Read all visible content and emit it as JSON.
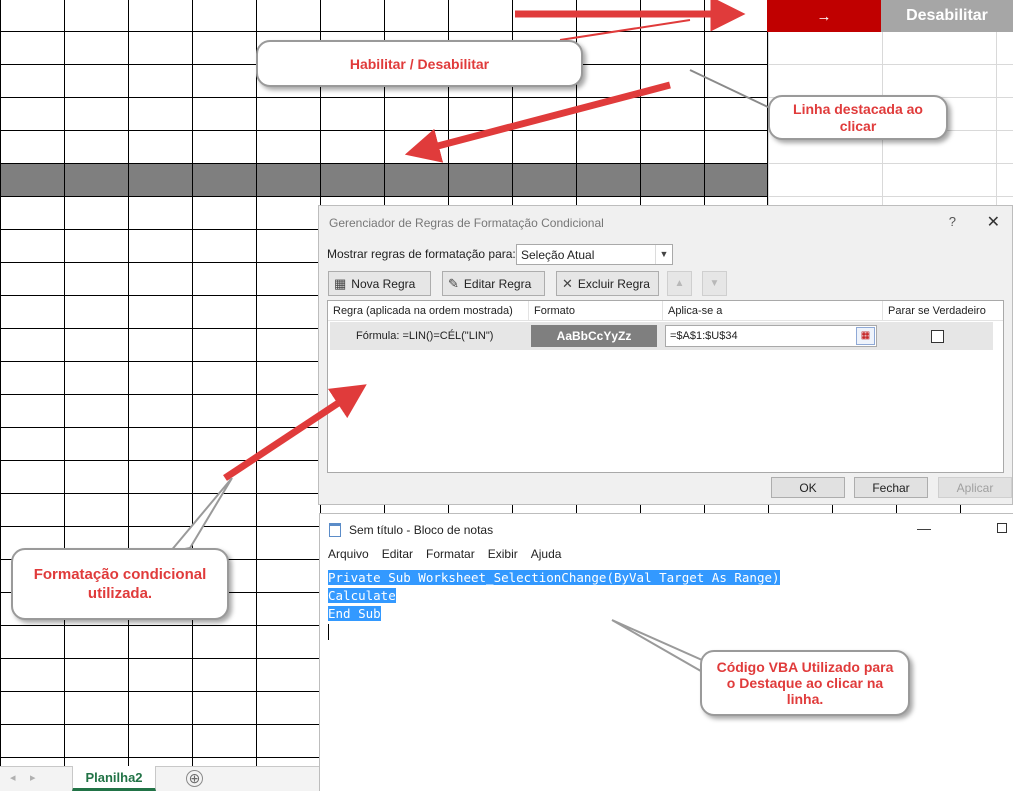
{
  "sheet": {
    "enable_button": "→",
    "disable_button": "Desabilitar",
    "tab_name": "Planilha2",
    "add_sheet": "⊕",
    "nav_prev": "◂",
    "nav_next": "▸"
  },
  "dialog": {
    "title": "Gerenciador de Regras de Formatação Condicional",
    "help": "?",
    "close": "✕",
    "show_rules_label": "Mostrar regras de formatação para:",
    "show_rules_value": "Seleção Atual",
    "buttons": {
      "new_rule": "Nova Regra",
      "edit_rule": "Editar Regra",
      "delete_rule": "Excluir Regra"
    },
    "columns": {
      "rule": "Regra (aplicada na ordem mostrada)",
      "format": "Formato",
      "applies_to": "Aplica-se a",
      "stop_if_true": "Parar se Verdadeiro"
    },
    "rule": {
      "formula": "Fórmula: =LIN()=CÉL(\"LIN\")",
      "preview": "AaBbCcYyZz",
      "applies_to": "=$A$1:$U$34"
    },
    "ok": "OK",
    "close_button": "Fechar",
    "apply": "Aplicar"
  },
  "notepad": {
    "title": "Sem título - Bloco de notas",
    "minimize": "—",
    "menu": [
      "Arquivo",
      "Editar",
      "Formatar",
      "Exibir",
      "Ajuda"
    ],
    "lines": [
      "Private Sub Worksheet_SelectionChange(ByVal Target As Range)",
      "Calculate",
      "End Sub"
    ]
  },
  "callouts": {
    "toggle": "Habilitar / Desabilitar",
    "highlight": "Linha destacada ao clicar",
    "conditional": "Formatação condicional utilizada.",
    "vba": "Código VBA Utilizado para o Destaque ao clicar na linha."
  },
  "colors": {
    "accent_red": "#c00000",
    "annotation_red": "#e03b3b",
    "highlight_gray": "#7f7f7f",
    "selection_blue": "#3399ff",
    "excel_green": "#217346"
  }
}
